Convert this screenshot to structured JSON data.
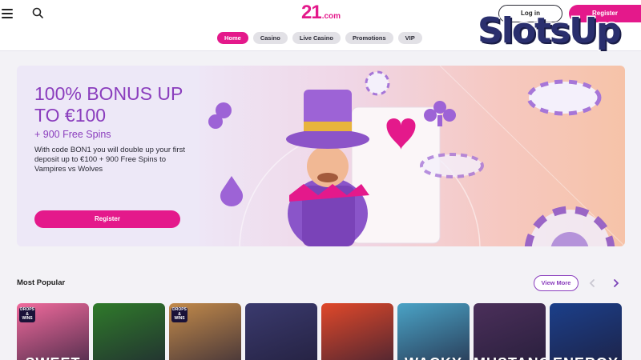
{
  "header": {
    "logo_number": "21",
    "logo_domain": ".com",
    "login_label": "Log in",
    "register_label": "Register",
    "nav": [
      {
        "label": "Home",
        "active": true
      },
      {
        "label": "Casino",
        "active": false
      },
      {
        "label": "Live Casino",
        "active": false
      },
      {
        "label": "Promotions",
        "active": false
      },
      {
        "label": "VIP",
        "active": false
      }
    ]
  },
  "watermark": {
    "text": "SlotsUp"
  },
  "banner": {
    "title": "100% BONUS UP TO €100",
    "subtitle": "+ 900 Free Spins",
    "description": "With code BON1 you will double up your first deposit up to €100 + 900 Free Spins to Vampires vs Wolves",
    "button_label": "Register"
  },
  "popular": {
    "title": "Most Popular",
    "view_more": "View More",
    "games": [
      {
        "title": "SWEET",
        "badge": "DROPS & WINS",
        "bg": "#f06a9c"
      },
      {
        "title": "",
        "badge": "",
        "bg": "#2f7a2a"
      },
      {
        "title": "",
        "badge": "DROPS & WINS",
        "bg": "#c28a4a"
      },
      {
        "title": "",
        "badge": "",
        "bg": "#3a3a6e"
      },
      {
        "title": "",
        "badge": "",
        "bg": "#e0482a"
      },
      {
        "title": "WACKY",
        "badge": "",
        "bg": "#4aa3c6"
      },
      {
        "title": "MUSTANG",
        "badge": "",
        "bg": "#4b2f5a"
      },
      {
        "title": "ENERGY",
        "badge": "",
        "bg": "#1b3f8a"
      }
    ]
  },
  "colors": {
    "brand_pink": "#e4198b",
    "brand_purple": "#8a3dbd"
  }
}
